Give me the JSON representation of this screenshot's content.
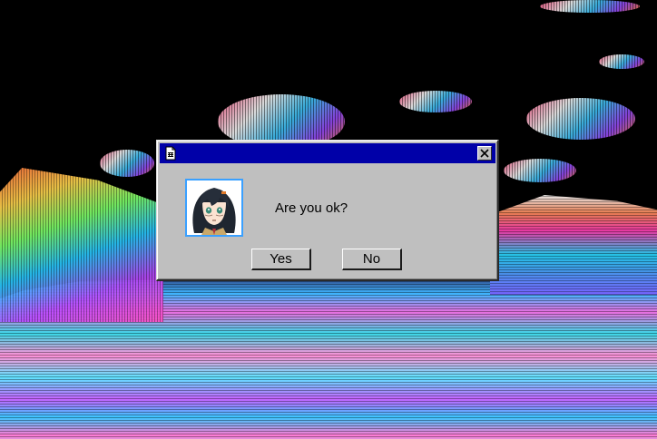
{
  "background": {
    "description_icon": "glitch-wallpaper"
  },
  "dialog": {
    "title": "",
    "title_icon": "document-icon",
    "close_icon": "close-icon",
    "avatar_icon": "anime-girl-avatar",
    "message": "Are you ok?",
    "buttons": {
      "yes_label": "Yes",
      "no_label": "No"
    },
    "colors": {
      "titlebar": "#0000a8",
      "face": "#bfbfbf",
      "avatar_border": "#3aa0ff"
    }
  }
}
